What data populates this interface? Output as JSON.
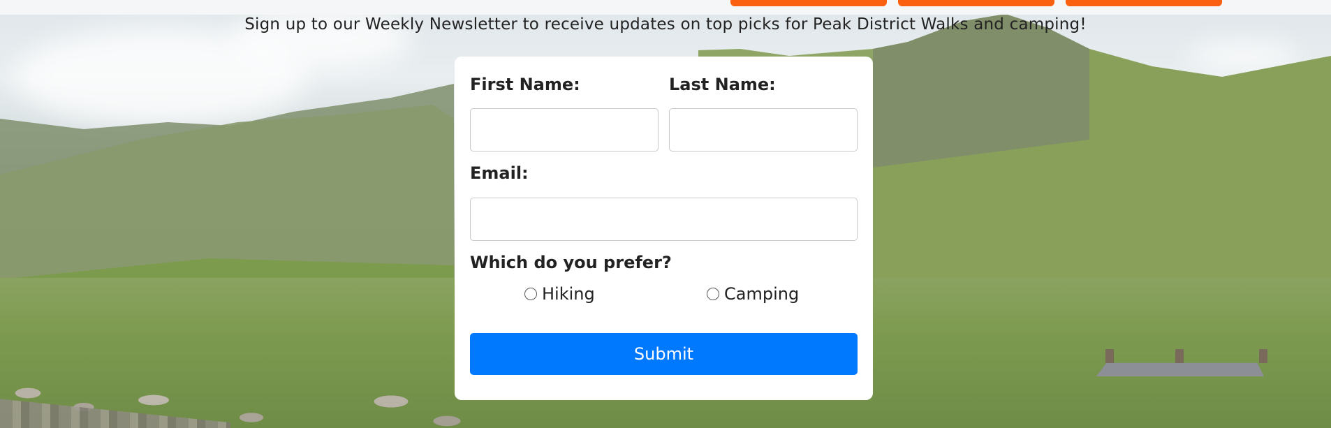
{
  "nav": {
    "buttons": [
      {
        "label": ""
      },
      {
        "label": ""
      },
      {
        "label": ""
      }
    ],
    "accent": "#fb5f10"
  },
  "intro_text": "Sign up to our Weekly Newsletter to receive updates on top picks for Peak District Walks and camping!",
  "form": {
    "first_name_label": "First Name:",
    "first_name_value": "",
    "last_name_label": "Last Name:",
    "last_name_value": "",
    "email_label": "Email:",
    "email_value": "",
    "preference_label": "Which do you prefer?",
    "options": [
      {
        "label": "Hiking",
        "selected": false
      },
      {
        "label": "Camping",
        "selected": false
      }
    ],
    "submit_label": "Submit",
    "submit_color": "#0079ff"
  }
}
